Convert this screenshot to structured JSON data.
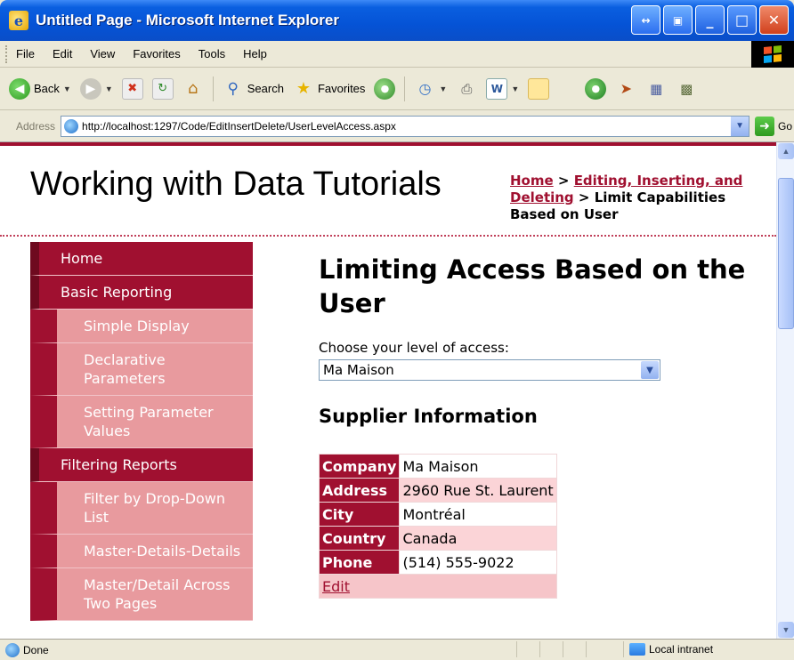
{
  "window": {
    "title": "Untitled Page - Microsoft Internet Explorer",
    "buttons": {
      "extra_a": "↔",
      "extra_b": "▣",
      "minimize": "_",
      "maximize": "□",
      "close": "✕"
    }
  },
  "menu": [
    "File",
    "Edit",
    "View",
    "Favorites",
    "Tools",
    "Help"
  ],
  "toolbar": {
    "back_label": "Back",
    "search_label": "Search",
    "favorites_label": "Favorites"
  },
  "address": {
    "label": "Address",
    "url": "http://localhost:1297/Code/EditInsertDelete/UserLevelAccess.aspx",
    "go_label": "Go"
  },
  "page": {
    "site_title": "Working with Data Tutorials",
    "breadcrumb": {
      "home": "Home",
      "sep1": " > ",
      "section": "Editing, Inserting, and Deleting",
      "sep2": " > ",
      "current": "Limit Capabilities Based on User"
    },
    "sidebar": [
      {
        "label": "Home",
        "level": "top"
      },
      {
        "label": "Basic Reporting",
        "level": "top"
      },
      {
        "label": "Simple Display",
        "level": "sub"
      },
      {
        "label": "Declarative Parameters",
        "level": "sub"
      },
      {
        "label": "Setting Parameter Values",
        "level": "sub"
      },
      {
        "label": "Filtering Reports",
        "level": "top"
      },
      {
        "label": "Filter by Drop-Down List",
        "level": "sub"
      },
      {
        "label": "Master-Details-Details",
        "level": "sub"
      },
      {
        "label": "Master/Detail Across Two Pages",
        "level": "sub"
      }
    ],
    "heading": "Limiting Access Based on the User",
    "access_label": "Choose your level of access:",
    "access_value": "Ma Maison",
    "section_heading": "Supplier Information",
    "supplier": {
      "rows": [
        {
          "label": "Company",
          "value": "Ma Maison"
        },
        {
          "label": "Address",
          "value": "2960 Rue St. Laurent"
        },
        {
          "label": "City",
          "value": "Montréal"
        },
        {
          "label": "Country",
          "value": "Canada"
        },
        {
          "label": "Phone",
          "value": "(514) 555-9022"
        }
      ],
      "edit_label": "Edit"
    }
  },
  "status": {
    "text": "Done",
    "zone": "Local intranet"
  },
  "colors": {
    "accent": "#a01030",
    "sidebar_sub": "#e89a9e",
    "row_alt": "#fbd4d7"
  }
}
